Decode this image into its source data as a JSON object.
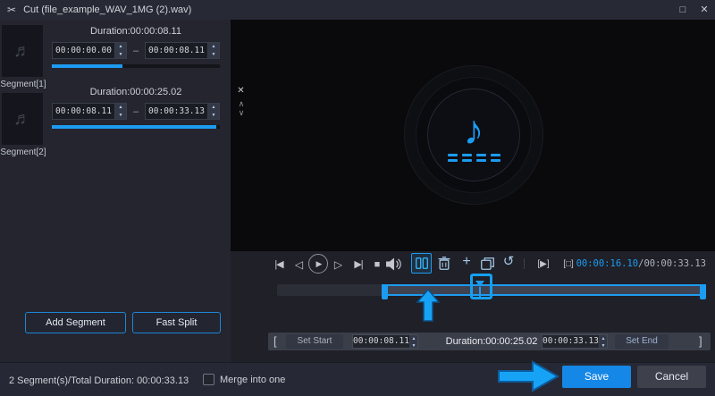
{
  "colors": {
    "accent": "#1d9bf0"
  },
  "icons": {
    "scissors": "✂",
    "maximize": "□",
    "close": "✕",
    "remove_segment": "✕",
    "move_up": "∧",
    "move_down": "∨",
    "thumb_note": "♬",
    "preview_note": "♪",
    "skip_start": "|◀",
    "frame_back": "◁",
    "play": "▶",
    "frame_forward": "▷",
    "skip_end": "▶|",
    "stop": "■",
    "plus": "+",
    "reset": "↺",
    "loop_play": "[▶]",
    "loop_stop": "[□]",
    "spin_up": "▲",
    "spin_down": "▼",
    "range_dash": "–",
    "bracket_open": "[",
    "bracket_close": "]"
  },
  "titlebar": {
    "title": "Cut (file_example_WAV_1MG (2).wav)"
  },
  "segments": {
    "items": [
      {
        "label": "Segment[1]",
        "duration": "Duration:00:00:08.11",
        "start": "00:00:00.00",
        "end": "00:00:08.11",
        "progress_pct": 42
      },
      {
        "label": "Segment[2]",
        "duration": "Duration:00:00:25.02",
        "start": "00:00:08.11",
        "end": "00:00:33.13",
        "progress_pct": 98
      }
    ],
    "add_segment": "Add Segment",
    "fast_split": "Fast Split"
  },
  "player": {
    "current": "00:00:16.10",
    "separator": "/",
    "total": "00:00:33.13"
  },
  "timeline": {
    "selection_start_pct": 24.4,
    "selection_width_pct": 75.6,
    "playhead_pct": 47.3
  },
  "trim": {
    "set_start": "Set Start",
    "start": "00:00:08.11",
    "duration": "Duration:00:00:25.02",
    "end": "00:00:33.13",
    "set_end": "Set End"
  },
  "footer": {
    "summary": "2 Segment(s)/Total Duration: 00:00:33.13",
    "merge": "Merge into one",
    "save": "Save",
    "cancel": "Cancel"
  }
}
